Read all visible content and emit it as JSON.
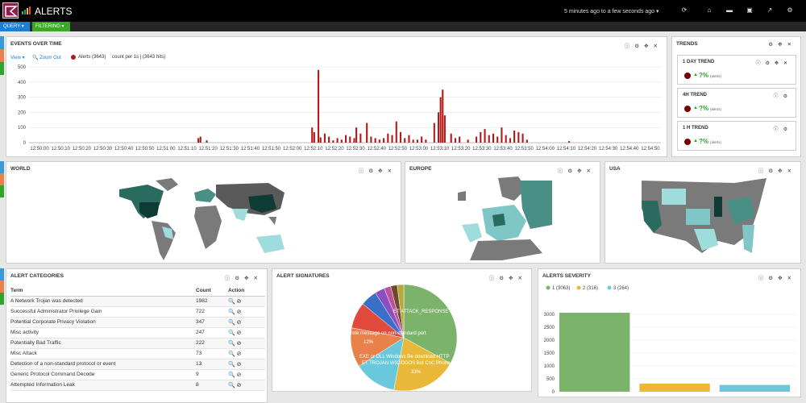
{
  "header": {
    "title": "ALERTS",
    "timespan": "5 minutes ago to a few seconds ago ▾"
  },
  "tabs": {
    "query": "QUERY ▾",
    "filtering": "FILTERING ▾"
  },
  "events_panel": {
    "title": "EVENTS OVER TIME",
    "view": "View ▾",
    "zoom_out": "Zoom Out",
    "legend": "Alerts (3643)",
    "count_text": "count per 1s | (3643 hits)"
  },
  "trends": {
    "title": "TRENDS",
    "items": [
      {
        "label": "1 DAY TREND",
        "pct": "?%",
        "note": "(alerts)"
      },
      {
        "label": "4H TREND",
        "pct": "?%",
        "note": "(alerts)"
      },
      {
        "label": "1 H TREND",
        "pct": "?%",
        "note": "(alerts)"
      }
    ]
  },
  "maps": {
    "world": "WORLD",
    "europe": "EUROPE",
    "usa": "USA"
  },
  "categories": {
    "title": "ALERT CATEGORIES",
    "headers": [
      "Term",
      "Count",
      "Action"
    ],
    "rows": [
      {
        "term": "A Network Trojan was detected",
        "count": "1982"
      },
      {
        "term": "Successful Administrator Privilege Gain",
        "count": "722"
      },
      {
        "term": "Potential Corporate Privacy Violation",
        "count": "347"
      },
      {
        "term": "Misc activity",
        "count": "247"
      },
      {
        "term": "Potentially Bad Traffic",
        "count": "222"
      },
      {
        "term": "Misc Attack",
        "count": "73"
      },
      {
        "term": "Detection of a non-standard protocol or event",
        "count": "13"
      },
      {
        "term": "Generic Protocol Command Decode",
        "count": "9"
      },
      {
        "term": "Attempted Information Leak",
        "count": "8"
      }
    ]
  },
  "signatures": {
    "title": "ALERT SIGNATURES",
    "labels": [
      "ET ATTACK_RESPONSE Pos",
      "rote message on non-standard port",
      "12%",
      "EXE or DLL Windows file download HTTP",
      "ET TROJAN W32/DDOS Bot CnC Phone Home",
      "33%"
    ]
  },
  "severity": {
    "title": "ALERTS SEVERITY"
  },
  "chart_data": [
    {
      "type": "bar",
      "title": "EVENTS OVER TIME",
      "ylim": [
        0,
        500
      ],
      "yticks": [
        0,
        100,
        200,
        300,
        400,
        500
      ],
      "xticks": [
        "12:50:00",
        "12:50:10",
        "12:50:20",
        "12:50:30",
        "12:50:40",
        "12:50:50",
        "12:51:00",
        "12:51:10",
        "12:51:20",
        "12:51:30",
        "12:51:40",
        "12:51:50",
        "12:52:00",
        "12:52:10",
        "12:52:20",
        "12:52:30",
        "12:52:40",
        "12:52:50",
        "12:53:00",
        "12:53:10",
        "12:53:20",
        "12:53:30",
        "12:53:40",
        "12:53:50",
        "12:54:00",
        "12:54:10",
        "12:54:20",
        "12:54:30",
        "12:54:40",
        "12:54:50"
      ],
      "series": [
        {
          "name": "Alerts (3643)",
          "color": "#b11a1a",
          "points": [
            [
              80,
              30
            ],
            [
              81,
              40
            ],
            [
              84,
              15
            ],
            [
              134,
              100
            ],
            [
              135,
              70
            ],
            [
              137,
              480
            ],
            [
              138,
              35
            ],
            [
              140,
              60
            ],
            [
              142,
              40
            ],
            [
              144,
              15
            ],
            [
              146,
              30
            ],
            [
              148,
              20
            ],
            [
              150,
              50
            ],
            [
              152,
              40
            ],
            [
              154,
              30
            ],
            [
              155,
              100
            ],
            [
              157,
              60
            ],
            [
              160,
              130
            ],
            [
              162,
              40
            ],
            [
              164,
              30
            ],
            [
              166,
              20
            ],
            [
              168,
              30
            ],
            [
              170,
              60
            ],
            [
              172,
              50
            ],
            [
              174,
              140
            ],
            [
              176,
              70
            ],
            [
              178,
              30
            ],
            [
              180,
              50
            ],
            [
              182,
              20
            ],
            [
              184,
              20
            ],
            [
              186,
              40
            ],
            [
              188,
              20
            ],
            [
              192,
              130
            ],
            [
              194,
              200
            ],
            [
              195,
              300
            ],
            [
              196,
              350
            ],
            [
              197,
              180
            ],
            [
              200,
              60
            ],
            [
              202,
              30
            ],
            [
              204,
              40
            ],
            [
              208,
              20
            ],
            [
              212,
              40
            ],
            [
              214,
              70
            ],
            [
              216,
              90
            ],
            [
              218,
              50
            ],
            [
              220,
              60
            ],
            [
              222,
              40
            ],
            [
              224,
              100
            ],
            [
              226,
              50
            ],
            [
              228,
              30
            ],
            [
              230,
              80
            ],
            [
              232,
              70
            ],
            [
              234,
              60
            ],
            [
              236,
              20
            ],
            [
              256,
              10
            ]
          ]
        }
      ]
    },
    {
      "type": "pie",
      "title": "ALERT SIGNATURES",
      "slices": [
        {
          "label": "ET ATTACK_RESPONSE Pos",
          "value": 33,
          "color": "#7bb36b"
        },
        {
          "label": "EXE or DLL Windows file download HTTP",
          "value": 20,
          "color": "#e8b838"
        },
        {
          "label": "ET TROJAN W32/DDOS Bot CnC Phone Home",
          "value": 13,
          "color": "#6ac8dc"
        },
        {
          "label": "rote message on non-standard port",
          "value": 12,
          "color": "#e8824a"
        },
        {
          "label": "",
          "value": 8,
          "color": "#e04a3a"
        },
        {
          "label": "",
          "value": 5,
          "color": "#3a6fc8"
        },
        {
          "label": "",
          "value": 3,
          "color": "#8a4fc0"
        },
        {
          "label": "",
          "value": 2,
          "color": "#c04f9a"
        },
        {
          "label": "",
          "value": 2,
          "color": "#6b4a30"
        },
        {
          "label": "",
          "value": 2,
          "color": "#b8a83a"
        }
      ]
    },
    {
      "type": "bar",
      "title": "ALERTS SEVERITY",
      "ylim": [
        0,
        3500
      ],
      "yticks": [
        0,
        500,
        1000,
        1500,
        2000,
        2500,
        3000
      ],
      "categories": [
        "1 (3063)",
        "2 (316)",
        "3 (264)"
      ],
      "values": [
        3063,
        316,
        264
      ],
      "colors": [
        "#7bb36b",
        "#e8b838",
        "#6ac8dc"
      ]
    }
  ]
}
